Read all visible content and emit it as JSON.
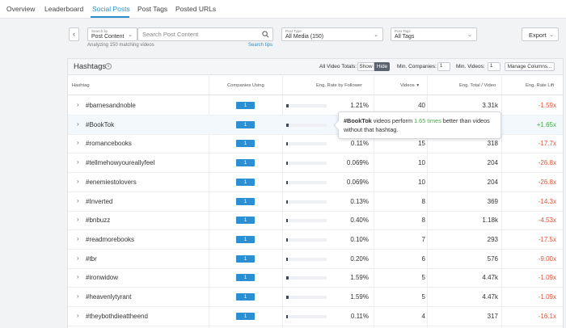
{
  "nav": {
    "tabs": [
      {
        "label": "Overview",
        "active": false
      },
      {
        "label": "Leaderboard",
        "active": false
      },
      {
        "label": "Social Posts",
        "active": true
      },
      {
        "label": "Post Tags",
        "active": false
      },
      {
        "label": "Posted URLs",
        "active": false
      }
    ]
  },
  "filters": {
    "search_by_label": "Search by",
    "search_by_value": "Post Content",
    "search_placeholder": "Search Post Content",
    "post_type_label": "Post Type",
    "post_type_value": "All Media (150)",
    "post_tags_label": "Post Tags",
    "post_tags_value": "All Tags",
    "analyzing": "Analyzing 150 matching videos",
    "search_tips": "Search tips",
    "export_label": "Export"
  },
  "panel": {
    "title": "Hashtags",
    "all_video_totals": "All Video Totals:",
    "show_label": "Show",
    "hide_label": "Hide",
    "min_companies_label": "Min. Companies:",
    "min_companies_value": "1",
    "min_videos_label": "Min. Videos:",
    "min_videos_value": "1",
    "manage_columns": "Manage Columns..."
  },
  "table": {
    "headers": {
      "hashtag": "Hashtag",
      "companies": "Companies Using",
      "eng_rate": "Eng. Rate by Follower",
      "videos": "Videos",
      "eng_total": "Eng. Total / Video",
      "eng_lift": "Eng. Rate Lift"
    },
    "rows": [
      {
        "tag": "#barnesandnoble",
        "companies": "1",
        "rate": "1.21%",
        "rate_fraction": 0.05,
        "videos": "40",
        "total": "3.31k",
        "lift": "-1.59x",
        "lift_positive": false
      },
      {
        "tag": "#BookTok",
        "companies": "1",
        "rate": "",
        "rate_fraction": 0.06,
        "videos": "",
        "total": "",
        "lift": "+1.65x",
        "lift_positive": true
      },
      {
        "tag": "#romancebooks",
        "companies": "1",
        "rate": "0.11%",
        "rate_fraction": 0.0,
        "videos": "15",
        "total": "318",
        "lift": "-17.7x",
        "lift_positive": false
      },
      {
        "tag": "#tellmehowyoureallyfeel",
        "companies": "1",
        "rate": "0.069%",
        "rate_fraction": 0.0,
        "videos": "10",
        "total": "204",
        "lift": "-26.8x",
        "lift_positive": false
      },
      {
        "tag": "#enemiestolovers",
        "companies": "1",
        "rate": "0.069%",
        "rate_fraction": 0.0,
        "videos": "10",
        "total": "204",
        "lift": "-26.8x",
        "lift_positive": false
      },
      {
        "tag": "#Inverted",
        "companies": "1",
        "rate": "0.13%",
        "rate_fraction": 0.0,
        "videos": "8",
        "total": "369",
        "lift": "-14.3x",
        "lift_positive": false
      },
      {
        "tag": "#bnbuzz",
        "companies": "1",
        "rate": "0.40%",
        "rate_fraction": 0.02,
        "videos": "8",
        "total": "1.18k",
        "lift": "-4.53x",
        "lift_positive": false
      },
      {
        "tag": "#readmorebooks",
        "companies": "1",
        "rate": "0.10%",
        "rate_fraction": 0.0,
        "videos": "7",
        "total": "293",
        "lift": "-17.5x",
        "lift_positive": false
      },
      {
        "tag": "#tbr",
        "companies": "1",
        "rate": "0.20%",
        "rate_fraction": 0.01,
        "videos": "6",
        "total": "576",
        "lift": "-9.00x",
        "lift_positive": false
      },
      {
        "tag": "#ironwidow",
        "companies": "1",
        "rate": "1.59%",
        "rate_fraction": 0.06,
        "videos": "5",
        "total": "4.47k",
        "lift": "-1.09x",
        "lift_positive": false
      },
      {
        "tag": "#heavenlytyrant",
        "companies": "1",
        "rate": "1.59%",
        "rate_fraction": 0.06,
        "videos": "5",
        "total": "4.47k",
        "lift": "-1.09x",
        "lift_positive": false
      },
      {
        "tag": "#theybothdieattheend",
        "companies": "1",
        "rate": "0.11%",
        "rate_fraction": 0.0,
        "videos": "4",
        "total": "317",
        "lift": "-16.1x",
        "lift_positive": false
      }
    ]
  },
  "tooltip": {
    "tag": "#BookTok",
    "text1": " videos perform ",
    "highlight": "1.65 times",
    "text2": " better than videos without that hashtag."
  },
  "colors": {
    "accent": "#2a8fc9",
    "badge": "#2b8fd1",
    "negative": "#e0533a",
    "positive": "#45a845"
  }
}
